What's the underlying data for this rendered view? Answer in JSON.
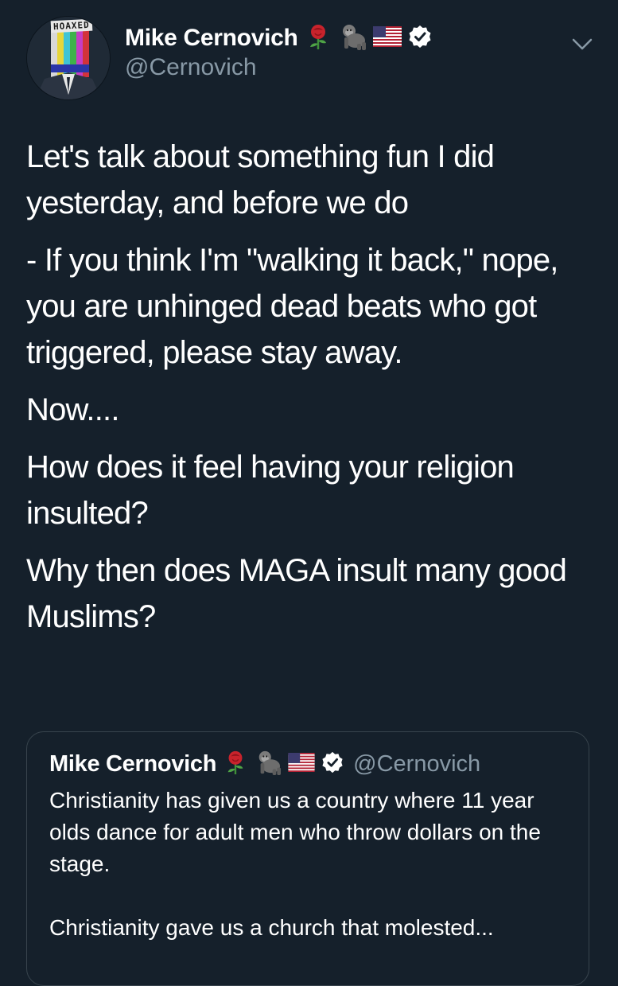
{
  "tweet": {
    "author": {
      "display_name": "Mike Cernovich",
      "handle": "@Cernovich",
      "avatar_text": "HOAXED",
      "emojis": [
        "rose-icon",
        "gorilla-icon",
        "us-flag-icon",
        "verified-badge-icon"
      ]
    },
    "body": [
      "Let's talk about something fun I did yesterday, and before we do",
      "- If you think I'm \"walking it back,\" nope, you are unhinged dead beats who got triggered, please stay away.",
      "Now....",
      "How does it feel having your religion insulted?",
      "Why then does MAGA insult many good Muslims?"
    ],
    "quoted": {
      "display_name": "Mike Cernovich",
      "handle": "@Cernovich",
      "text": [
        "Christianity has given us a country where 11 year olds dance for adult men who throw dollars on the stage.",
        "Christianity gave us a church that molested..."
      ]
    }
  },
  "colors": {
    "background": "#15202b",
    "text": "#ffffff",
    "secondary_text": "#8899a6",
    "border": "#38444d"
  }
}
